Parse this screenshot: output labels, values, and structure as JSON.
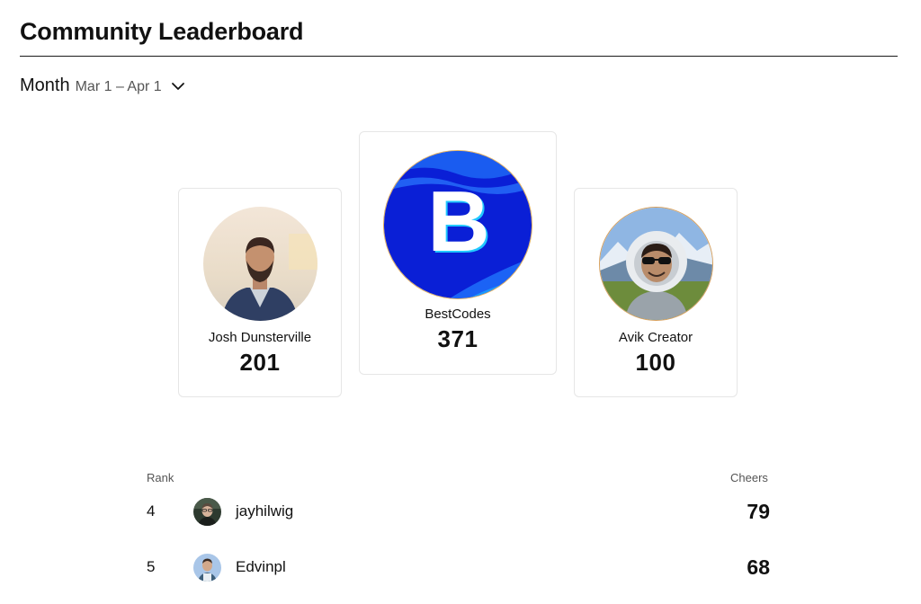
{
  "header": {
    "title": "Community Leaderboard"
  },
  "period": {
    "label": "Month",
    "range": "Mar 1 – Apr 1",
    "icon": "chevron-down-icon"
  },
  "podium": [
    {
      "place": 2,
      "name": "Josh Dunsterville",
      "cheers": "201",
      "avatar": "photo-man-beard"
    },
    {
      "place": 1,
      "name": "BestCodes",
      "cheers": "371",
      "avatar": "letter-b-logo",
      "avatar_letter": "B"
    },
    {
      "place": 3,
      "name": "Avik Creator",
      "cheers": "100",
      "avatar": "astronaut-illustration"
    }
  ],
  "list": {
    "headers": {
      "rank": "Rank",
      "cheers": "Cheers"
    },
    "rows": [
      {
        "rank": "4",
        "name": "jayhilwig",
        "cheers": "79"
      },
      {
        "rank": "5",
        "name": "Edvinpl",
        "cheers": "68"
      }
    ]
  },
  "colors": {
    "text": "#111111",
    "muted": "#555555",
    "card_border": "#e6e6e6",
    "bestcodes_blue": "#0a1fd6"
  }
}
